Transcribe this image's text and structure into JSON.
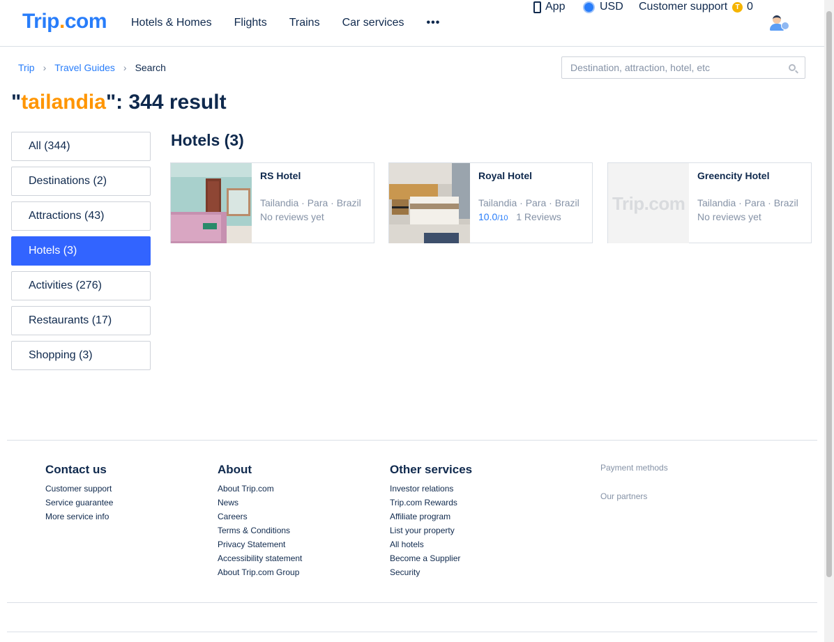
{
  "header": {
    "logo": {
      "part1": "Trip",
      "dot": ".",
      "part2": "com"
    },
    "nav": [
      "Hotels & Homes",
      "Flights",
      "Trains",
      "Car services"
    ],
    "more": "•••",
    "app_label": "App",
    "currency": "USD",
    "support_label": "Customer support",
    "coins": "0",
    "coin_symbol": "T"
  },
  "breadcrumb": {
    "items": [
      "Trip",
      "Travel Guides",
      "Search"
    ],
    "separator": "›"
  },
  "search": {
    "placeholder": "Destination, attraction, hotel, etc",
    "value": ""
  },
  "result_title": {
    "open_quote": "\"",
    "keyword": "tailandia",
    "rest": "\": 344 result"
  },
  "sidebar": {
    "items": [
      {
        "label": "All (344)",
        "active": false
      },
      {
        "label": "Destinations (2)",
        "active": false
      },
      {
        "label": "Attractions (43)",
        "active": false
      },
      {
        "label": "Hotels (3)",
        "active": true
      },
      {
        "label": "Activities (276)",
        "active": false
      },
      {
        "label": "Restaurants (17)",
        "active": false
      },
      {
        "label": "Shopping (3)",
        "active": false
      }
    ]
  },
  "hotels": {
    "title": "Hotels (3)",
    "items": [
      {
        "name": "RS Hotel",
        "location": "Tailandia · Para · Brazil",
        "reviews": "No reviews yet",
        "score": "",
        "score_max": ""
      },
      {
        "name": "Royal Hotel",
        "location": "Tailandia · Para · Brazil",
        "reviews": "1 Reviews",
        "score": "10.0",
        "score_max": "/10"
      },
      {
        "name": "Greencity Hotel",
        "location": "Tailandia · Para · Brazil",
        "reviews": "No reviews yet",
        "score": "",
        "score_max": "",
        "placeholder_logo": "Trip.com"
      }
    ]
  },
  "footer": {
    "contact": {
      "title": "Contact us",
      "links": [
        "Customer support",
        "Service guarantee",
        "More service info"
      ]
    },
    "about": {
      "title": "About",
      "links": [
        "About Trip.com",
        "News",
        "Careers",
        "Terms & Conditions",
        "Privacy Statement",
        "Accessibility statement",
        "About Trip.com Group"
      ]
    },
    "other": {
      "title": "Other services",
      "links": [
        "Investor relations",
        "Trip.com Rewards",
        "Affiliate program",
        "List your property",
        "All hotels",
        "Become a Supplier",
        "Security"
      ]
    },
    "payment_methods": "Payment methods",
    "our_partners": "Our partners"
  },
  "colors": {
    "brand_blue": "#287dfa",
    "brand_orange": "#ff9500",
    "active_tab": "#3264ff",
    "text_dark": "#0f294d",
    "text_muted": "#8592a6"
  }
}
